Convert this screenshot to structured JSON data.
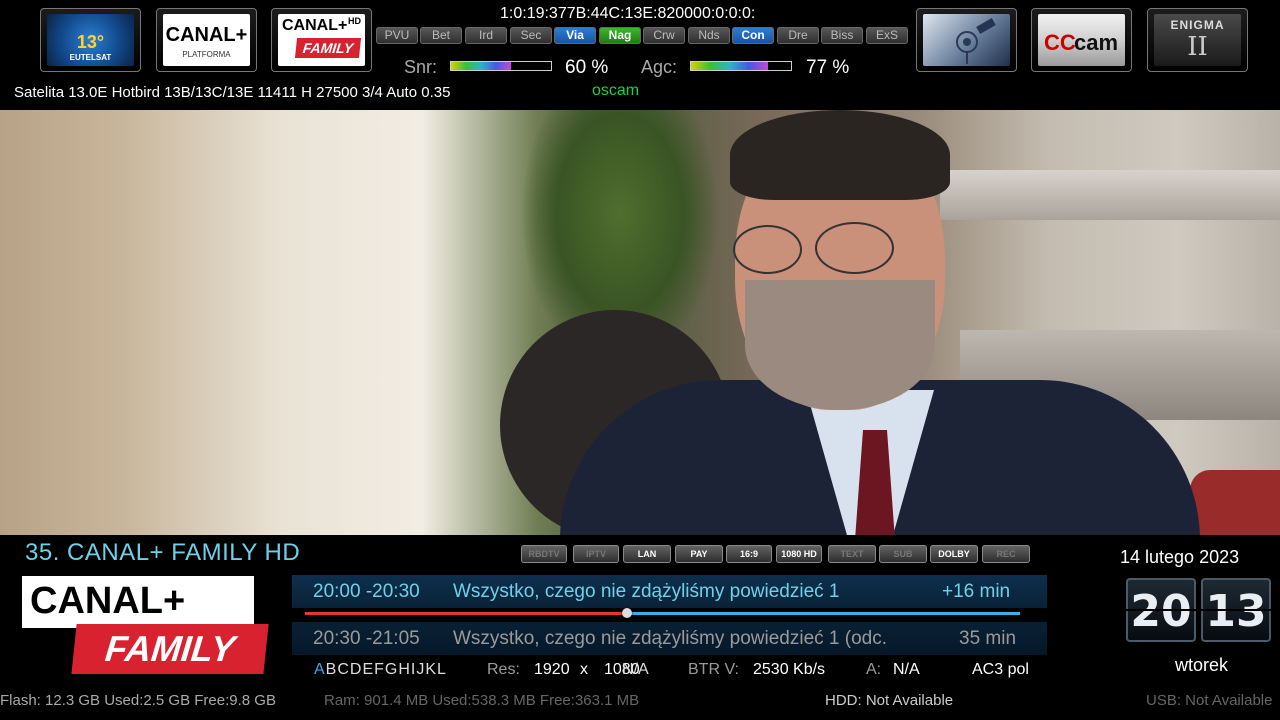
{
  "header": {
    "service_ref": "1:0:19:377B:44C:13E:820000:0:0:0:",
    "cam_systems": [
      {
        "label": "PVU",
        "state": "off"
      },
      {
        "label": "Bet",
        "state": "off"
      },
      {
        "label": "Ird",
        "state": "off"
      },
      {
        "label": "Sec",
        "state": "off"
      },
      {
        "label": "Via",
        "state": "available"
      },
      {
        "label": "Nag",
        "state": "active"
      },
      {
        "label": "Crw",
        "state": "off"
      },
      {
        "label": "Nds",
        "state": "off"
      },
      {
        "label": "Con",
        "state": "available"
      },
      {
        "label": "Dre",
        "state": "off"
      },
      {
        "label": "Biss",
        "state": "off"
      },
      {
        "label": "ExS",
        "state": "off"
      }
    ],
    "snr": {
      "label": "Snr:",
      "value": "60 %",
      "level": 0.6
    },
    "agc": {
      "label": "Agc:",
      "value": "77 %",
      "level": 0.77
    },
    "sat_info": "Satelita 13.0E Hotbird 13B/13C/13E 11411 H 27500 3/4  Auto 0.35",
    "cam_name": "oscam"
  },
  "logos": {
    "eutelsat": {
      "icon": "eutelsat-hotbird-logo",
      "number": "13°",
      "text": "EUTELSAT"
    },
    "canal_platforma": {
      "icon": "canal-plus-platforma-logo",
      "main": "CANAL+",
      "sub": "PLATFORMA"
    },
    "canal_family_small": {
      "icon": "canal-plus-family-hd-logo",
      "main": "CANAL+",
      "hd": "HD",
      "family": "FAMILY"
    },
    "satellite": {
      "icon": "satellite-dish-logo"
    },
    "cccam": {
      "icon": "cccam-logo",
      "red": "CC",
      "black": "cam"
    },
    "enigma": {
      "icon": "enigma2-logo",
      "top": "ENIGMA",
      "bottom": "II"
    }
  },
  "channel": {
    "name": "35. CANAL+ FAMILY HD",
    "logo": {
      "main": "CANAL+",
      "hd": "HD",
      "family": "FAMILY"
    }
  },
  "status_badges": [
    {
      "label": "RBDTV",
      "on": false
    },
    {
      "label": "IPTV",
      "on": false
    },
    {
      "label": "LAN",
      "on": true
    },
    {
      "label": "PAY",
      "on": true
    },
    {
      "label": "16:9",
      "on": true
    },
    {
      "label": "1080 HD",
      "on": true
    },
    {
      "label": "TEXT",
      "on": false
    },
    {
      "label": "SUB",
      "on": false
    },
    {
      "label": "DOLBY",
      "on": true
    },
    {
      "label": "REC",
      "on": false
    }
  ],
  "epg": {
    "now": {
      "time": "20:00 -20:30",
      "title": "Wszystko, czego nie zdążyliśmy powiedzieć 1",
      "remaining": "+16 min",
      "progress": 0.45
    },
    "next": {
      "time": "20:30  -21:05",
      "title": "Wszystko, czego nie zdążyliśmy powiedzieć 1 (odc.",
      "duration": "35 min"
    }
  },
  "info_row": {
    "letters_highlight": "A",
    "letters_rest": "BCDEFGHIJKL",
    "res_label": "Res:",
    "res_w": "1920",
    "res_x": "x",
    "res_h": "1080",
    "res_na": "N/A",
    "btr_label": "BTR  V:",
    "btr_value": "2530 Kb/s",
    "a_label": "A:",
    "a_value": "N/A",
    "audio": "AC3 pol"
  },
  "clock": {
    "date": "14 lutego 2023",
    "hour": "20",
    "minute": "13",
    "weekday": "wtorek"
  },
  "memory": {
    "flash": "Flash: 12.3 GB Used:2.5 GB Free:9.8 GB",
    "ram": "Ram: 901.4 MB Used:538.3 MB Free:363.1 MB",
    "hdd": "HDD: Not Available",
    "usb": "USB: Not Available"
  },
  "colors": {
    "accent": "#6fd1e9",
    "cam_active": "#1fd23a",
    "progress_red": "#e23a2a"
  }
}
